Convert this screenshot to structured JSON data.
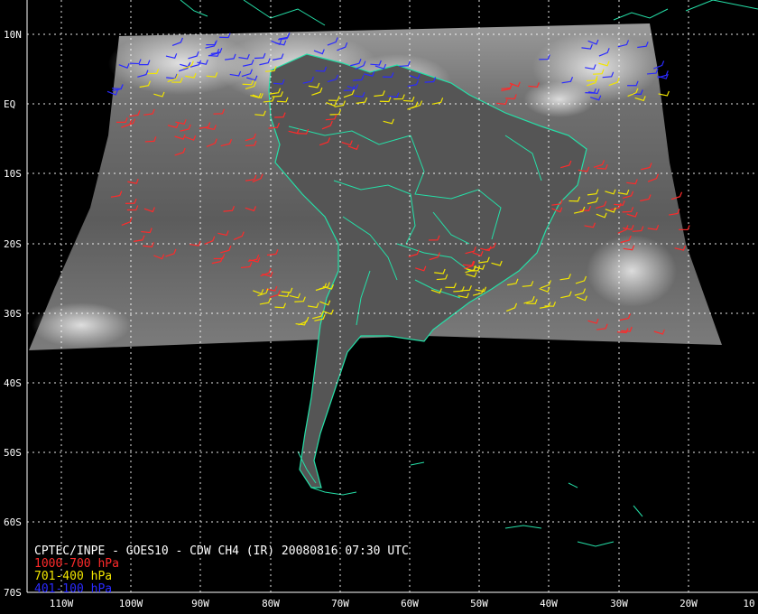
{
  "caption": {
    "title": "CPTEC/INPE - GOES10 - CDW CH4 (IR) 20080816 07:30 UTC",
    "legend": [
      {
        "label": "1000-700 hPa",
        "color": "#ff2a2a"
      },
      {
        "label": "701-400 hPa",
        "color": "#f2e600"
      },
      {
        "label": "401-100 hPa",
        "color": "#2a2aff"
      }
    ]
  },
  "grid": {
    "lat_labels": [
      "10N",
      "EQ",
      "10S",
      "20S",
      "30S",
      "40S",
      "50S",
      "60S",
      "70S"
    ],
    "lon_labels": [
      "110W",
      "100W",
      "90W",
      "80W",
      "70W",
      "60W",
      "50W",
      "40W",
      "30W",
      "20W",
      "10"
    ]
  },
  "colors": {
    "coast": "#25e0a8",
    "grid": "#ffffff",
    "background": "#000000",
    "imagery": "#7a7a7a"
  }
}
